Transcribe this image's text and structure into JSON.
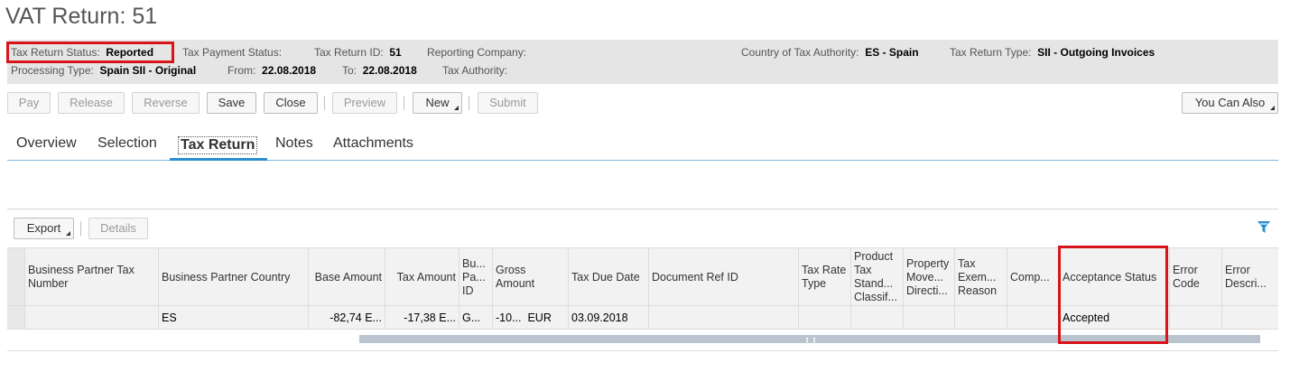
{
  "page": {
    "title": "VAT Return: 51"
  },
  "info": {
    "status_label": "Tax Return Status:",
    "status_value": "Reported",
    "payment_label": "Tax Payment Status:",
    "id_label": "Tax Return ID:",
    "id_value": "51",
    "company_label": "Reporting Company:",
    "country_label": "Country of Tax Authority:",
    "country_value": "ES - Spain",
    "type_label": "Tax Return Type:",
    "type_value": "SII - Outgoing Invoices",
    "proc_label": "Processing Type:",
    "proc_value": "Spain SII - Original",
    "from_label": "From:",
    "from_value": "22.08.2018",
    "to_label": "To:",
    "to_value": "22.08.2018",
    "authority_label": "Tax Authority:"
  },
  "toolbar": {
    "pay": "Pay",
    "release": "Release",
    "reverse": "Reverse",
    "save": "Save",
    "close": "Close",
    "preview": "Preview",
    "new": "New",
    "submit": "Submit",
    "you_can_also": "You Can Also"
  },
  "tabs": {
    "overview": "Overview",
    "selection": "Selection",
    "tax_return": "Tax Return",
    "notes": "Notes",
    "attachments": "Attachments"
  },
  "table_toolbar": {
    "export": "Export",
    "details": "Details"
  },
  "table": {
    "headers": {
      "bp_tax_number": "Business Partner Tax Number",
      "bp_country": "Business Partner Country",
      "base_amount": "Base Amount",
      "tax_amount": "Tax Amount",
      "bp_id": "Bu... Pa... ID",
      "gross_amount": "Gross Amount",
      "tax_due_date": "Tax Due Date",
      "doc_ref_id": "Document Ref ID",
      "tax_rate_type": "Tax Rate Type",
      "product_tax": "Product Tax Stand... Classif...",
      "property_move": "Property Move... Directi...",
      "tax_exemption": "Tax Exem... Reason",
      "comp": "Comp...",
      "acceptance_status": "Acceptance Status",
      "error_code": "Error Code",
      "error_descr": "Error Descri..."
    },
    "row": {
      "bp_country": "ES",
      "base_amount": "-82,74",
      "base_amount_ccy": "E...",
      "tax_amount": "-17,38",
      "tax_amount_ccy": "E...",
      "bp_id": "G...",
      "gross_amount": "-10...",
      "gross_ccy": "EUR",
      "tax_due_date": "03.09.2018",
      "acceptance_status": "Accepted"
    }
  },
  "colors": {
    "highlight": "#d7141a",
    "accent": "#2a8fd0",
    "filter_icon": "#2a8fd0"
  }
}
